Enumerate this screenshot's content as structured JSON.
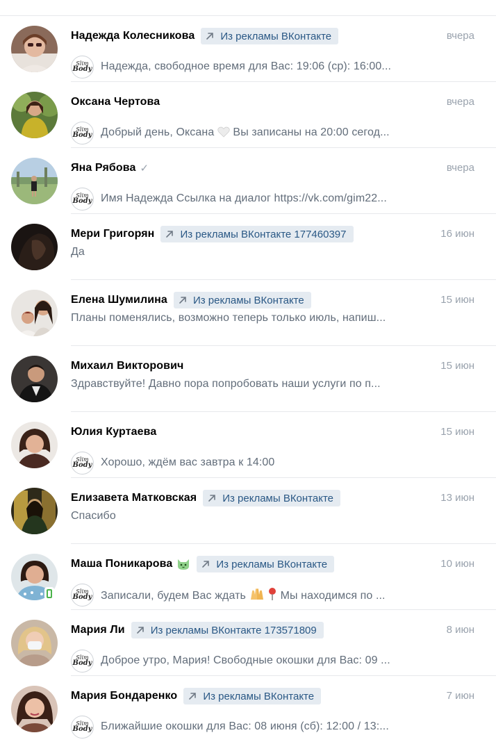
{
  "ad_tag_prefix": "Из рекламы ВКонтакте",
  "dialogs": [
    {
      "name": "Надежда Колесникова",
      "ad_label": "Из рекламы ВКонтакте",
      "date": "вчера",
      "message": "Надежда, свободное время для Вас: 19:06 (ср): 16:00...",
      "mini_avatar": "Slim Body"
    },
    {
      "name": "Оксана Чертова",
      "ad_label": "",
      "date": "вчера",
      "message_before_emoji": "Добрый день, Оксана",
      "message_after_emoji": "Вы записаны на 20:00 сегод...",
      "emoji": "white-heart-emoji",
      "mini_avatar": "Slim Body"
    },
    {
      "name": "Яна Рябова",
      "ad_label": "",
      "date": "вчера",
      "verified": "✓",
      "message": "Имя Надежда Ссылка на диалог https://vk.com/gim22...",
      "mini_avatar": "Slim Body"
    },
    {
      "name": "Мери Григорян",
      "ad_label": "Из рекламы ВКонтакте 177460397",
      "date": "16 июн",
      "message": "Да"
    },
    {
      "name": "Елена Шумилина",
      "ad_label": "Из рекламы ВКонтакте",
      "date": "15 июн",
      "message": "Планы поменялись, возможно теперь только июль, напиш..."
    },
    {
      "name": "Михаил Викторович",
      "ad_label": "",
      "date": "15 июн",
      "message": "Здравствуйте! Давно пора попробовать наши услуги по п..."
    },
    {
      "name": "Юлия Куртаева",
      "ad_label": "",
      "date": "15 июн",
      "message": "Хорошо, ждём вас завтра к 14:00",
      "mini_avatar": "Slim Body"
    },
    {
      "name": "Елизавета Матковская",
      "ad_label": "Из рекламы ВКонтакте",
      "date": "13 июн",
      "message": "Спасибо"
    },
    {
      "name": "Маша Поникарова",
      "ad_label": "Из рекламы ВКонтакте",
      "date": "10 июн",
      "name_emoji": "cat-face-emoji",
      "message_before_emoji": "Записали, будем Вас ждать",
      "message_after_emoji": "Мы находимся по ...",
      "emoji": "raised-hands-and-pin-emoji",
      "mini_avatar": "Slim Body",
      "online_mobile": true
    },
    {
      "name": "Мария Ли",
      "ad_label": "Из рекламы ВКонтакте 173571809",
      "date": "8 июн",
      "message": "Доброе утро, Мария! Свободные окошки для Вас: 09 ...",
      "mini_avatar": "Slim Body"
    },
    {
      "name": "Мария Бондаренко",
      "ad_label": "Из рекламы ВКонтакте",
      "date": "7 июн",
      "message": "Ближайшие окошки для Вас: 08 июня (сб): 12:00 / 13:...",
      "mini_avatar": "Slim Body"
    }
  ],
  "colors": {
    "name": "#000000",
    "ad_tag_bg": "#e5ebf1",
    "ad_tag_text": "#2a5885",
    "date": "#99a2ad",
    "message": "#626d7a",
    "divider": "#e7e8ec",
    "online": "#4bb34b"
  }
}
